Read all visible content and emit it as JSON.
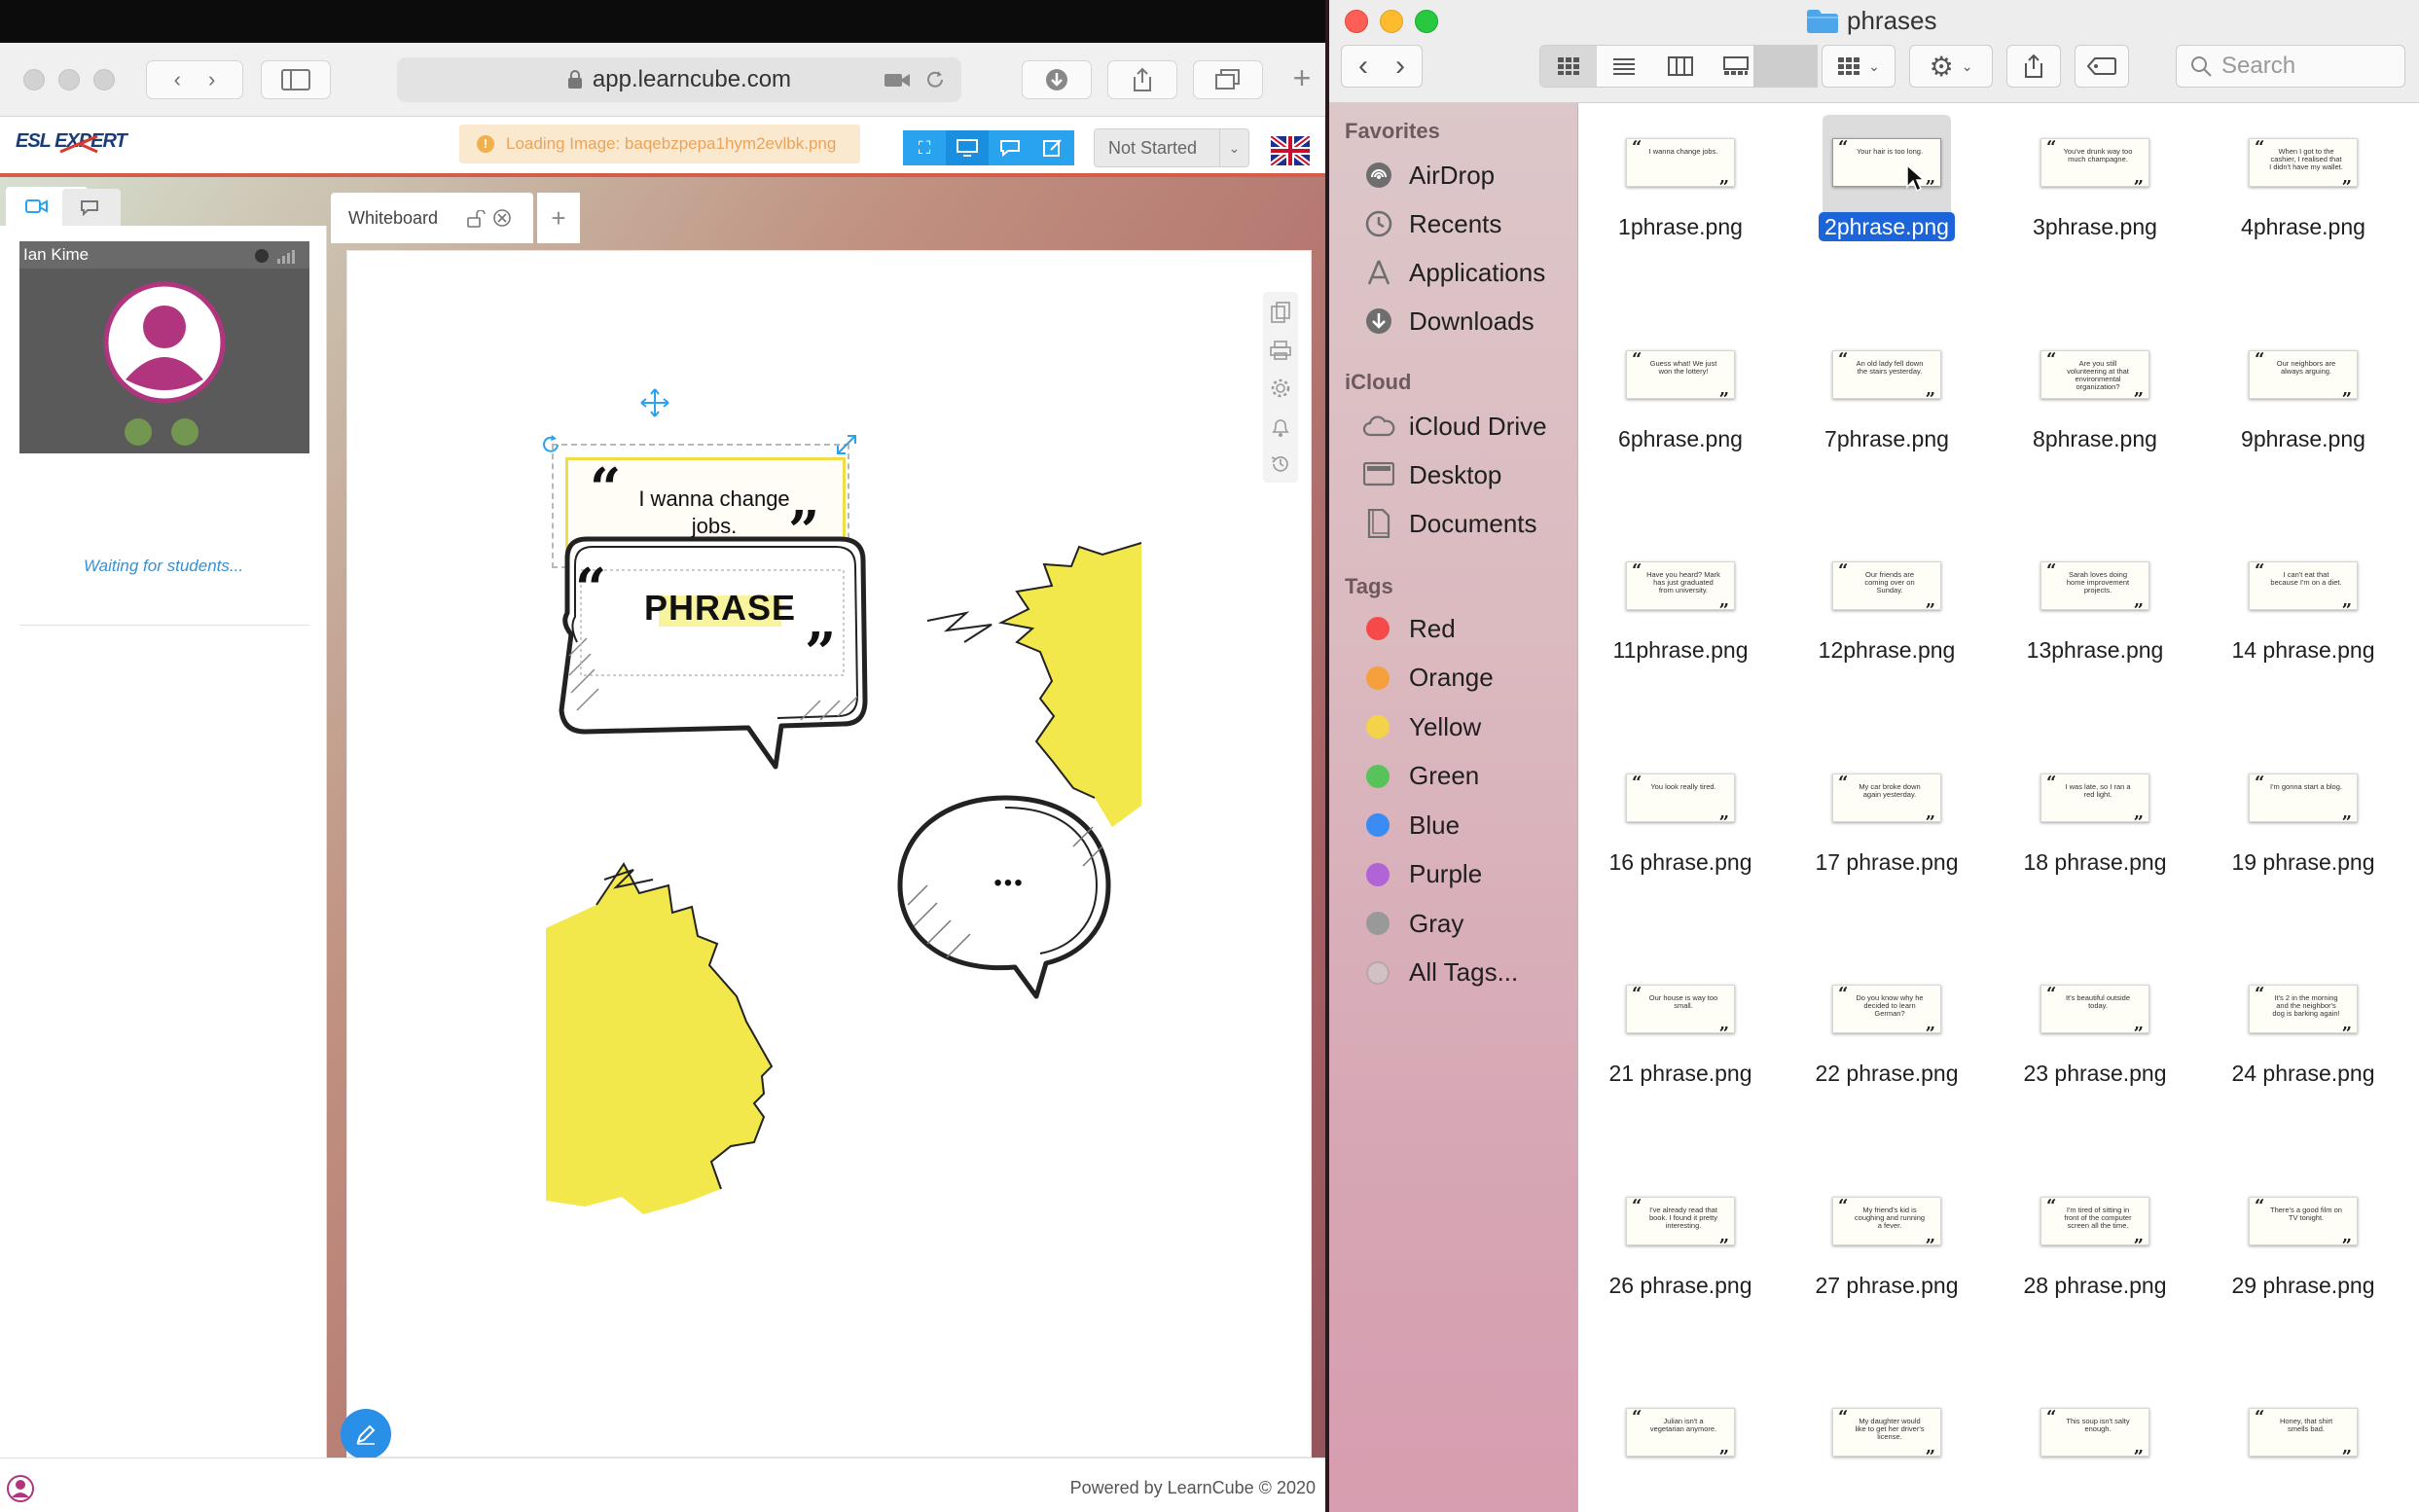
{
  "safari": {
    "url": "app.learncube.com",
    "logo": "ESL EXPERT",
    "loading_message": "Loading Image: baqebzpepa1hym2evlbk.png",
    "status_select": "Not Started",
    "participant_name": "Ian Kime",
    "waiting_text": "Waiting for students...",
    "whiteboard_tab": "Whiteboard",
    "add_tab_label": "+",
    "phrase_card_text": "I wanna change jobs.",
    "phrase_bubble_text": "PHRASE",
    "ellipsis_text": "•••",
    "footer_text": "Powered by LearnCube © 2020"
  },
  "finder": {
    "window_title": "phrases",
    "search_placeholder": "Search",
    "favorites_header": "Favorites",
    "favorites": [
      {
        "label": "AirDrop",
        "icon": "airdrop-icon"
      },
      {
        "label": "Recents",
        "icon": "recents-icon"
      },
      {
        "label": "Applications",
        "icon": "applications-icon"
      },
      {
        "label": "Downloads",
        "icon": "downloads-icon"
      }
    ],
    "icloud_header": "iCloud",
    "icloud": [
      {
        "label": "iCloud Drive",
        "icon": "icloud-icon"
      },
      {
        "label": "Desktop",
        "icon": "desktop-icon"
      },
      {
        "label": "Documents",
        "icon": "documents-icon"
      }
    ],
    "tags_header": "Tags",
    "tags": [
      {
        "label": "Red",
        "color": "#f44a4a"
      },
      {
        "label": "Orange",
        "color": "#f5a03c"
      },
      {
        "label": "Yellow",
        "color": "#f4d34b"
      },
      {
        "label": "Green",
        "color": "#58c35a"
      },
      {
        "label": "Blue",
        "color": "#3a8cf2"
      },
      {
        "label": "Purple",
        "color": "#b064d6"
      },
      {
        "label": "Gray",
        "color": "#999999"
      },
      {
        "label": "All Tags...",
        "color": "#d2c2c6"
      }
    ],
    "files": [
      {
        "name": "1phrase.png",
        "text": "I wanna change jobs.",
        "selected": false
      },
      {
        "name": "2phrase.png",
        "text": "Your hair is too long.",
        "selected": true
      },
      {
        "name": "3phrase.png",
        "text": "You've drunk way too much champagne.",
        "selected": false
      },
      {
        "name": "4phrase.png",
        "text": "When I got to the cashier, I realised that I didn't have my wallet.",
        "selected": false
      },
      {
        "name": "6phrase.png",
        "text": "Guess what! We just won the lottery!",
        "selected": false
      },
      {
        "name": "7phrase.png",
        "text": "An old lady fell down the stairs yesterday.",
        "selected": false
      },
      {
        "name": "8phrase.png",
        "text": "Are you still volunteering at that environmental organization?",
        "selected": false
      },
      {
        "name": "9phrase.png",
        "text": "Our neighbors are always arguing.",
        "selected": false
      },
      {
        "name": "11phrase.png",
        "text": "Have you heard? Mark has just graduated from university.",
        "selected": false
      },
      {
        "name": "12phrase.png",
        "text": "Our friends are coming over on Sunday.",
        "selected": false
      },
      {
        "name": "13phrase.png",
        "text": "Sarah loves doing home improvement projects.",
        "selected": false
      },
      {
        "name": "14 phrase.png",
        "text": "I can't eat that because I'm on a diet.",
        "selected": false
      },
      {
        "name": "16 phrase.png",
        "text": "You look really tired.",
        "selected": false
      },
      {
        "name": "17 phrase.png",
        "text": "My car broke down again yesterday.",
        "selected": false
      },
      {
        "name": "18 phrase.png",
        "text": "I was late, so I ran a red light.",
        "selected": false
      },
      {
        "name": "19 phrase.png",
        "text": "I'm gonna start a blog.",
        "selected": false
      },
      {
        "name": "21 phrase.png",
        "text": "Our house is way too small.",
        "selected": false
      },
      {
        "name": "22 phrase.png",
        "text": "Do you know why he decided to learn German?",
        "selected": false
      },
      {
        "name": "23 phrase.png",
        "text": "It's beautiful outside today.",
        "selected": false
      },
      {
        "name": "24 phrase.png",
        "text": "It's 2 in the morning and the neighbor's dog is barking again!",
        "selected": false
      },
      {
        "name": "26 phrase.png",
        "text": "I've already read that book. I found it pretty interesting.",
        "selected": false
      },
      {
        "name": "27 phrase.png",
        "text": "My friend's kid is coughing and running a fever.",
        "selected": false
      },
      {
        "name": "28 phrase.png",
        "text": "I'm tired of sitting in front of the computer screen all the time.",
        "selected": false
      },
      {
        "name": "29 phrase.png",
        "text": "There's a good film on TV tonight.",
        "selected": false
      },
      {
        "name": "",
        "text": "Julian isn't a vegetarian anymore.",
        "selected": false
      },
      {
        "name": "",
        "text": "My daughter would like to get her driver's license.",
        "selected": false
      },
      {
        "name": "",
        "text": "This soup isn't salty enough.",
        "selected": false
      },
      {
        "name": "",
        "text": "Honey, that shirt smells bad.",
        "selected": false
      }
    ]
  }
}
